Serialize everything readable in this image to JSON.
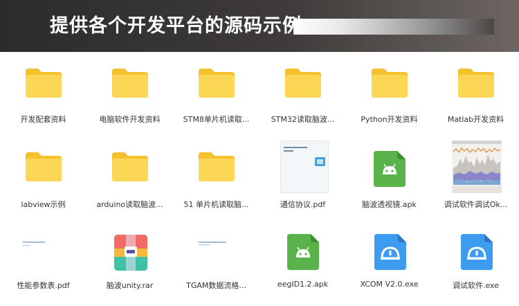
{
  "header": {
    "title": "提供各个开发平台的源码示例"
  },
  "colors": {
    "folder_back": "#f6c12e",
    "folder_front": "#fcd756",
    "apk_green": "#5ab34a",
    "xcom_blue": "#3d9cf0"
  },
  "files": [
    {
      "name": "开发配套资料",
      "icon": "folder-icon"
    },
    {
      "name": "电脑软件开发资料",
      "icon": "folder-icon"
    },
    {
      "name": "STM8单片机读取...",
      "icon": "folder-icon"
    },
    {
      "name": "STM32读取脑波...",
      "icon": "folder-icon"
    },
    {
      "name": "Python开发资料",
      "icon": "folder-icon"
    },
    {
      "name": "Matlab开发资料",
      "icon": "folder-icon"
    },
    {
      "name": "labview示例",
      "icon": "folder-icon"
    },
    {
      "name": "arduino读取脑波...",
      "icon": "folder-icon"
    },
    {
      "name": "51 单片机读取脑...",
      "icon": "folder-icon"
    },
    {
      "name": "通信协议.pdf",
      "icon": "pdf-thumbnail-icon"
    },
    {
      "name": "脑波透视镜.apk",
      "icon": "android-apk-icon"
    },
    {
      "name": "调试软件调试Ok...",
      "icon": "chart-thumbnail-icon"
    },
    {
      "name": "性能参数表.pdf",
      "icon": "pdf-thumbnail-icon"
    },
    {
      "name": "脑波unity.rar",
      "icon": "winrar-archive-icon"
    },
    {
      "name": "TGAM数据流格...",
      "icon": "pdf-thumbnail-icon"
    },
    {
      "name": "eegID1.2.apk",
      "icon": "android-apk-icon"
    },
    {
      "name": "XCOM V2.0.exe",
      "icon": "xcom-app-icon"
    },
    {
      "name": "调试软件.exe",
      "icon": "xcom-app-icon"
    }
  ]
}
